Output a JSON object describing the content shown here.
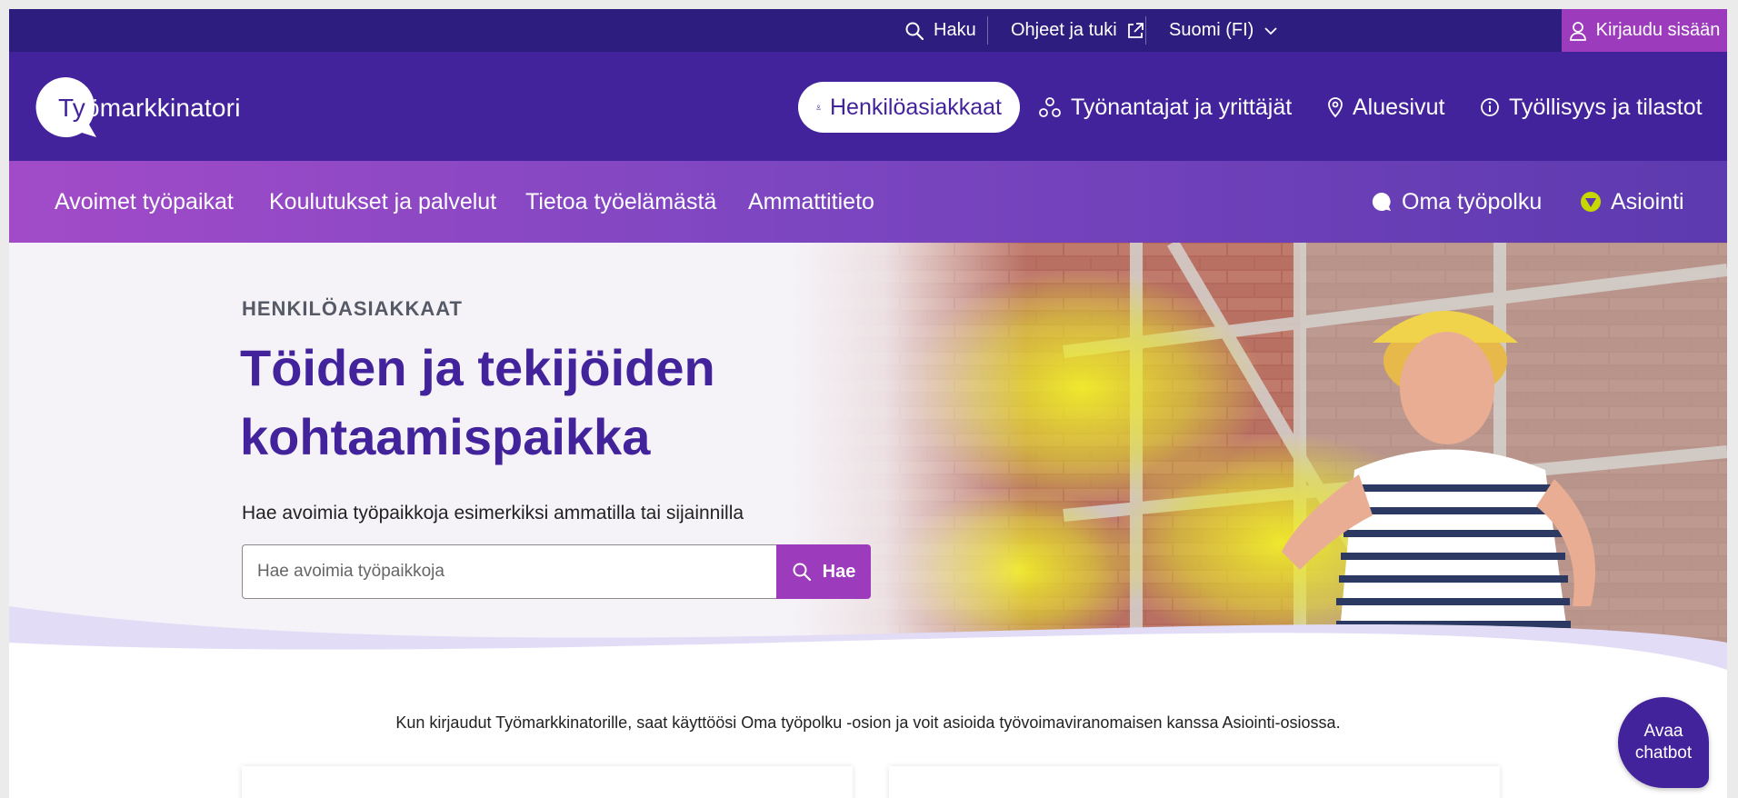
{
  "utility": {
    "search_label": "Haku",
    "help_label": "Ohjeet ja tuki",
    "language_label": "Suomi (FI)",
    "login_label": "Kirjaudu sisään"
  },
  "header": {
    "logo_text_dark": "Ty",
    "logo_text_light": "ömarkkinatori",
    "audiences": [
      {
        "label": "Henkilöasiakkaat",
        "active": true
      },
      {
        "label": "Työnantajat ja yrittäjät"
      },
      {
        "label": "Aluesivut"
      },
      {
        "label": "Työllisyys ja tilastot"
      }
    ]
  },
  "section_nav": {
    "items": [
      "Avoimet työpaikat",
      "Koulutukset ja palvelut",
      "Tietoa työelämästä",
      "Ammattitieto"
    ],
    "oma_tyopolku": "Oma työpolku",
    "asiointi": "Asiointi"
  },
  "hero": {
    "eyebrow": "HENKILÖASIAKKAAT",
    "title": "Töiden ja tekijöiden kohtaamispaikka",
    "search_label": "Hae avoimia työpaikkoja esimerkiksi ammatilla tai sijainnilla",
    "search_placeholder": "Hae avoimia työpaikkoja",
    "search_button": "Hae"
  },
  "info_text": "Kun kirjaudut Työmarkkinatorille, saat käyttöösi Oma työpolku -osion ja voit asioida työvoimaviranomaisen kanssa Asiointi-osiossa.",
  "chatbot": {
    "line1": "Avaa",
    "line2": "chatbot"
  },
  "colors": {
    "utility_bg": "#2c1d7e",
    "header_bg": "#43239c",
    "accent": "#9d3bbd",
    "asiointi_icon": "#c6d800"
  }
}
